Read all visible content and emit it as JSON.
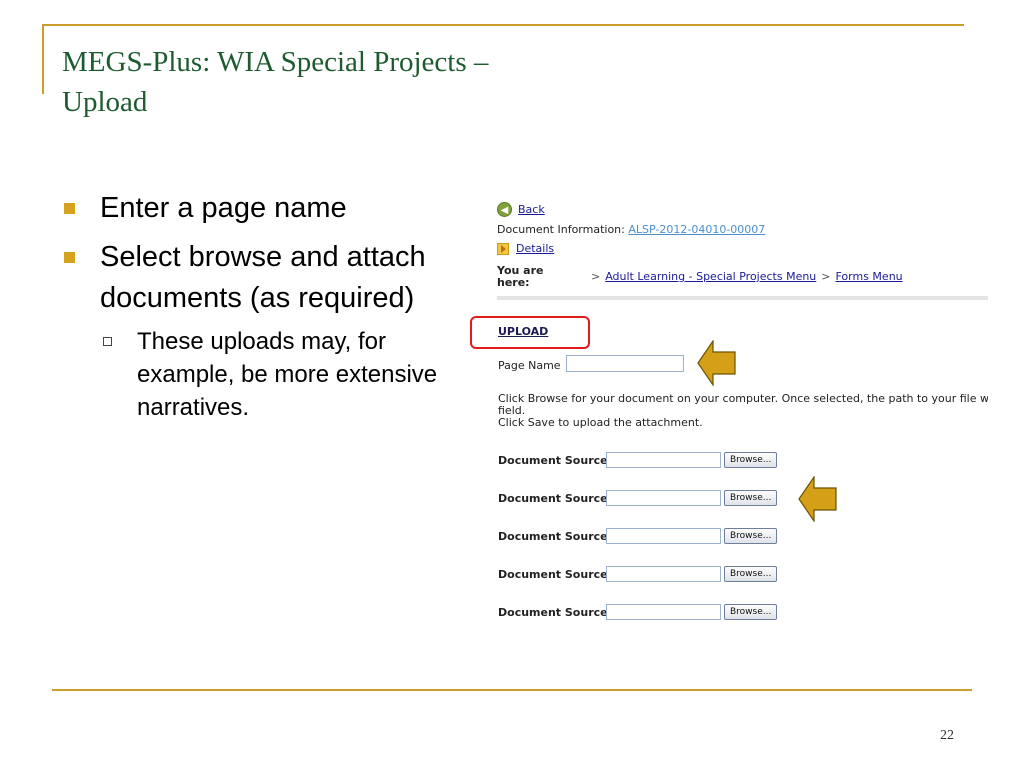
{
  "slide": {
    "title_line1": "MEGS-Plus: WIA Special Projects –",
    "title_line2": "Upload",
    "bullets": [
      {
        "text": "Enter a page name"
      },
      {
        "text": "Select browse and attach documents (as required)"
      }
    ],
    "sub_bullet": "These uploads may, for example, be more extensive narratives.",
    "page_number": "22",
    "accent_color": "#cc9d2a",
    "title_color": "#1e5c2f"
  },
  "screen": {
    "back_label": "Back",
    "doc_info_label": "Document Information:",
    "doc_id": "ALSP-2012-04010-00007",
    "details_label": "Details",
    "you_are_here": "You are here:",
    "breadcrumbs": [
      "Adult Learning - Special Projects Menu",
      "Forms Menu"
    ],
    "upload_heading": "UPLOAD",
    "page_name_label": "Page Name",
    "page_name_value": "",
    "instruction_line1": "Click Browse for your document on your computer. Once selected, the path to your file w",
    "instruction_line2": "field.",
    "instruction_line3": "Click Save to upload the attachment.",
    "source_label": "Document Source",
    "browse_label": "Browse...",
    "document_sources": [
      {
        "value": ""
      },
      {
        "value": ""
      },
      {
        "value": ""
      },
      {
        "value": ""
      },
      {
        "value": ""
      }
    ]
  }
}
